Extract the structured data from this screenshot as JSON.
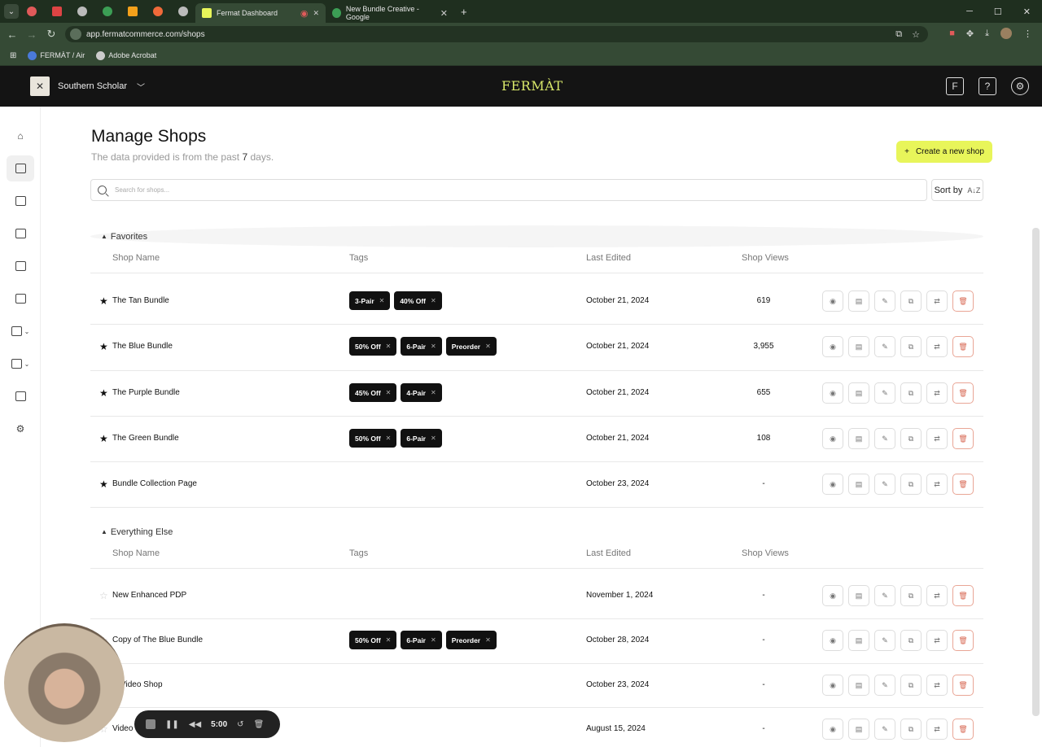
{
  "browser": {
    "tabs": [
      {
        "label": "Fermat Dashboard",
        "active": true
      },
      {
        "label": "New Bundle Creative - Google",
        "active": false
      }
    ],
    "new_tab": "+",
    "url": "app.fermatcommerce.com/shops",
    "bookmarks": [
      "FERMÀT / Air",
      "Adobe Acrobat"
    ]
  },
  "header": {
    "store_name": "Southern Scholar",
    "brand": "FERMÀT"
  },
  "page": {
    "title": "Manage Shops",
    "subtitle_prefix": "The data provided is from the past",
    "subtitle_days": "7",
    "subtitle_suffix": "days.",
    "create_button": "Create a new shop",
    "search_placeholder": "Search for shops...",
    "sort_label": "Sort by",
    "sort_icon": "A↓Z"
  },
  "columns": {
    "shop_name": "Shop Name",
    "tags": "Tags",
    "last_edited": "Last Edited",
    "shop_views": "Shop Views"
  },
  "favorites": {
    "label": "Favorites",
    "rows": [
      {
        "name": "The Tan Bundle",
        "tags": [
          "3-Pair",
          "40% Off"
        ],
        "date": "October 21, 2024",
        "views": "619",
        "starred": true
      },
      {
        "name": "The Blue Bundle",
        "tags": [
          "50% Off",
          "6-Pair",
          "Preorder"
        ],
        "date": "October 21, 2024",
        "views": "3,955",
        "starred": true
      },
      {
        "name": "The Purple Bundle",
        "tags": [
          "45% Off",
          "4-Pair"
        ],
        "date": "October 21, 2024",
        "views": "655",
        "starred": true
      },
      {
        "name": "The Green Bundle",
        "tags": [
          "50% Off",
          "6-Pair"
        ],
        "date": "October 21, 2024",
        "views": "108",
        "starred": true
      },
      {
        "name": "Bundle Collection Page",
        "tags": [],
        "date": "October 23, 2024",
        "views": "-",
        "starred": true
      }
    ]
  },
  "everything_else": {
    "label": "Everything Else",
    "rows": [
      {
        "name": "New Enhanced PDP",
        "tags": [],
        "date": "November 1, 2024",
        "views": "-",
        "starred": false
      },
      {
        "name": "Copy of The Blue Bundle",
        "tags": [
          "50% Off",
          "6-Pair",
          "Preorder"
        ],
        "date": "October 28, 2024",
        "views": "-",
        "starred": false
      },
      {
        "name": "w Video Shop",
        "tags": [],
        "date": "October 23, 2024",
        "views": "-",
        "starred": false
      },
      {
        "name": "Video",
        "tags": [],
        "date": "August 15, 2024",
        "views": "-",
        "starred": false
      }
    ]
  },
  "recorder": {
    "time": "5:00"
  },
  "colors": {
    "accent": "#e8f55a",
    "header_bg": "#141414",
    "brand": "#d8e86a",
    "delete": "#d86a55"
  }
}
